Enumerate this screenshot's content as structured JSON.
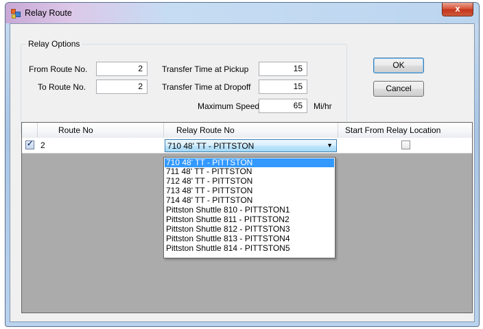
{
  "window": {
    "title": "Relay Route",
    "close_glyph": "x"
  },
  "relay_options": {
    "legend": "Relay Options",
    "from_route_label": "From Route No.",
    "from_route_value": "2",
    "to_route_label": "To Route No.",
    "to_route_value": "2",
    "transfer_pickup_label": "Transfer Time at Pickup",
    "transfer_pickup_value": "15",
    "transfer_dropoff_label": "Transfer Time at Dropoff",
    "transfer_dropoff_value": "15",
    "max_speed_label": "Maximum Speed",
    "max_speed_value": "65",
    "max_speed_unit": "Mi/hr"
  },
  "buttons": {
    "ok": "OK",
    "cancel": "Cancel"
  },
  "grid": {
    "columns": [
      "Route No",
      "Relay Route No",
      "Start From Relay Location"
    ],
    "rows": [
      {
        "selected": true,
        "route_no": "2",
        "relay_route": "710 48' TT - PITTSTON",
        "start_from_relay": false
      }
    ]
  },
  "dropdown": {
    "selected_index": 0,
    "options": [
      "710 48' TT - PITTSTON",
      "711 48' TT - PITTSTON",
      "712 48' TT - PITTSTON",
      "713 48' TT - PITTSTON",
      "714 48' TT - PITTSTON",
      "Pittston Shuttle 810 - PITTSTON1",
      "Pittston Shuttle 811 - PITTSTON2",
      "Pittston Shuttle 812 - PITTSTON3",
      "Pittston Shuttle 813 - PITTSTON4",
      "Pittston Shuttle 814 - PITTSTON5"
    ]
  },
  "icons": {
    "app": "relay-route-app-icon",
    "close": "close-icon",
    "check": "checkmark-icon",
    "dropdown_arrow": "chevron-down-icon"
  },
  "colors": {
    "selection": "#3399ff",
    "grid_background": "#ababab",
    "close_button": "#c2351d"
  }
}
